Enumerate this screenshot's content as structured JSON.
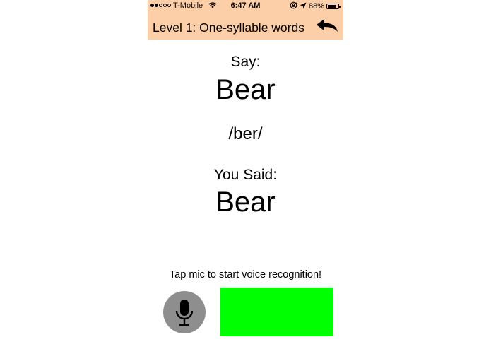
{
  "status_bar": {
    "carrier": "T-Mobile",
    "time": "6:47 AM",
    "battery": "88%",
    "battery_level": 0.88,
    "signal_bars": 2,
    "signal_total": 5,
    "icons": [
      "wifi-icon",
      "orientation-lock-icon",
      "location-arrow-icon",
      "battery-icon"
    ]
  },
  "header": {
    "title": "Level 1: One-syllable words",
    "back_icon": "back-arrow-icon",
    "background_color": "#fdcfa8"
  },
  "main": {
    "say_label": "Say:",
    "target_word": "Bear",
    "phonetic": "/ber/",
    "you_said_label": "You Said:",
    "spoken_word": "Bear"
  },
  "footer": {
    "instruction": "Tap mic to start voice recognition!",
    "mic_icon": "microphone-icon",
    "mic_button_color": "#8e8e8e",
    "result_color": "#00ff00"
  }
}
